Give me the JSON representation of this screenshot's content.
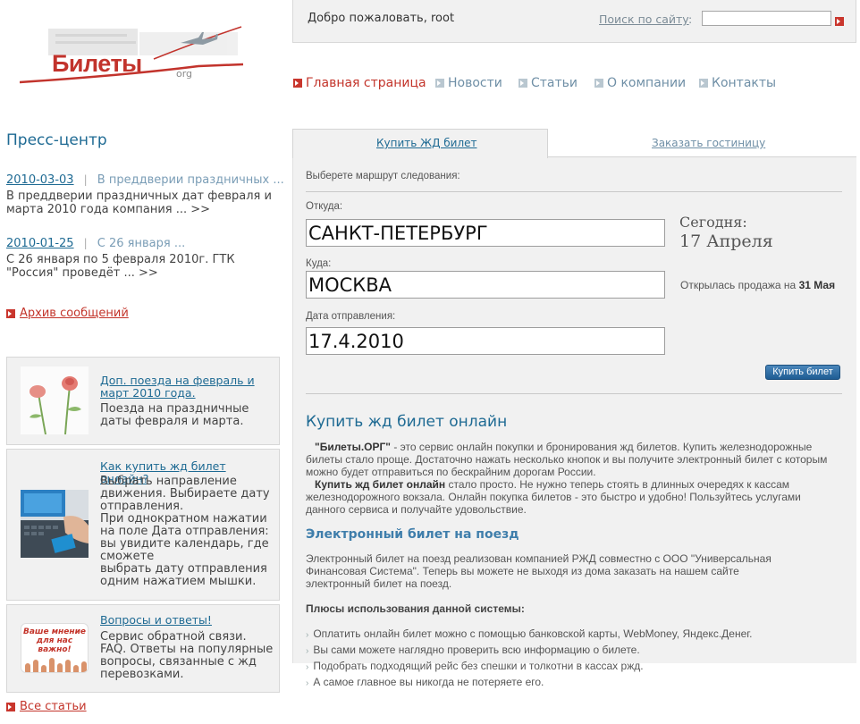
{
  "logo": {
    "text": "Билеты",
    "suffix": "org"
  },
  "header": {
    "welcome": "Добро пожаловать, root",
    "search_label": "Поиск по сайту",
    "search_colon": ":",
    "search_value": ""
  },
  "nav": {
    "items": [
      {
        "label": "Главная страница",
        "active": true
      },
      {
        "label": "Новости",
        "active": false
      },
      {
        "label": "Статьи",
        "active": false
      },
      {
        "label": "О компании",
        "active": false
      },
      {
        "label": "Контакты",
        "active": false
      }
    ]
  },
  "sidebar": {
    "title": "Пресс-центр",
    "sep": "|",
    "news": [
      {
        "date": "2010-03-03",
        "headline": "В преддверии праздничных ...",
        "body": "В преддверии праздничных дат февраля и марта 2010 года компания ... >>"
      },
      {
        "date": "2010-01-25",
        "headline": "С 26 января ...",
        "body": "С 26 января по 5 февраля 2010г. ГТК \"Россия\" проведёт ... >>"
      }
    ],
    "archive": "Архив сообщений",
    "cards": [
      {
        "link": "Доп. поезда на февраль и март 2010 года.",
        "text": "Поезда на праздничные даты февраля и марта."
      },
      {
        "link": "Как купить жд билет онлайн?",
        "text": "Выбрать направление движения. Выбираете дату отправления.\nПри однократном нажатии на поле Дата отправления: вы увидите календарь, где сможете\nвыбрать дату отправления одним нажатием мышки."
      },
      {
        "link": "Вопросы и ответы!",
        "text": "Сервис обратной связи. FAQ. Ответы на популярные вопросы, связанные с жд перевозками.",
        "img_text": "Ваше мнение для нас важно!"
      }
    ],
    "all_articles": "Все статьи"
  },
  "tabs": [
    {
      "label": "Купить ЖД билет",
      "active": true
    },
    {
      "label": "Заказать гостиницу",
      "active": false
    }
  ],
  "form": {
    "route_label": "Выберете маршрут следования:",
    "from_label": "Откуда:",
    "from_value": "САНКТ-ПЕТЕРБУРГ",
    "to_label": "Куда:",
    "to_value": "МОСКВА",
    "date_label": "Дата отправления:",
    "date_value": "17.4.2010",
    "today_label": "Сегодня:",
    "today_date": "17 Апреля",
    "sale_text": "Открылась продажа на",
    "sale_date": "31 Мая",
    "buy_button": "Купить билет"
  },
  "content": {
    "h_online": "Купить жд билет онлайн",
    "p1_brand": "\"Билеты.ОРГ\"",
    "p1_a": " - это сервис онлайн покупки и бронирования жд билетов. Купить железнодорожные билеты стало проще. Достаточно нажать несколько кнопок и вы получите электронный билет с которым можно будет отправиться по бескрайним дорогам России.",
    "p1_bold": "Купить жд билет онлайн",
    "p1_b": " стало просто. Не нужно теперь стоять в длинных очередях к кассам железнодорожного вокзала. Онлайн покупка билетов - это быстро и удобно! Пользуйтесь услугами данного сервиса и получайте удовольствие.",
    "h_eticket": "Электронный билет на поезд",
    "p2": "Электронный билет на поезд реализован компанией РЖД совместно с ООО \"Универсальная Финансовая Система\". Теперь вы можете не выходя из дома заказать на нашем сайте электронный билет на поезд.",
    "h_plus": "Плюсы использования данной системы:",
    "bullets": [
      "Оплатить онлайн билет можно с помощью банковской карты, WebMoney, Яндекс.Денег.",
      "Вы сами можете наглядно проверить всю информацию о билете.",
      "Подобрать подходящий рейс без спешки и толкотни в кассах ржд.",
      "А самое главное вы никогда не потеряете его."
    ]
  }
}
